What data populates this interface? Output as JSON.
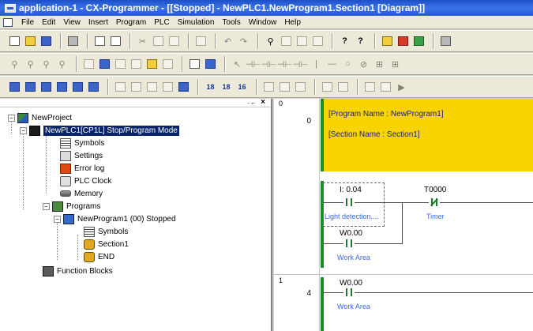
{
  "window": {
    "title": "application-1 - CX-Programmer - [[Stopped] - NewPLC1.NewProgram1.Section1 [Diagram]]"
  },
  "menu": [
    "File",
    "Edit",
    "View",
    "Insert",
    "Program",
    "PLC",
    "Simulation",
    "Tools",
    "Window",
    "Help"
  ],
  "toolbar_icons": {
    "row1": [
      "new-icon",
      "open-icon",
      "save-icon",
      "cut-icon",
      "print-icon",
      "print-preview-icon",
      "cut-icon",
      "copy-icon",
      "paste-icon",
      "grid-icon",
      "undo-icon",
      "redo-icon",
      "find-icon",
      "replace-icon",
      "find-next-icon",
      "properties-icon",
      "help-icon",
      "context-help-icon",
      "online-icon",
      "transfer-icon",
      "monitor-icon"
    ],
    "row2": [
      "zoom-fit-icon",
      "zoom-out-icon",
      "zoom-in-icon",
      "zoom-icon",
      "cross-ref-icon",
      "list-icon",
      "window-icon",
      "contact-no-icon",
      "contact-nc-icon",
      "or-no-icon",
      "or-nc-icon",
      "vertical-icon",
      "coil-icon",
      "coil-nc-icon",
      "instruction-icon",
      "fb-icon"
    ],
    "row3": [
      "toggle-workspace-icon",
      "toggle-output-icon",
      "watch-icon",
      "address-ref-icon",
      "io-table-icon",
      "settings-icon",
      "compile-icon",
      "check-icon",
      "online-edit-icon",
      "upload-icon",
      "download-icon",
      "plc-mode-icon",
      "run-icon",
      "stop-icon",
      "monitor-icon"
    ]
  },
  "toolbar_labels": {
    "zoom_a": "18",
    "zoom_b": "18",
    "zoom_c": "16"
  },
  "project_tree": {
    "root": "NewProject",
    "plc": "NewPLC1[CP1L] Stop/Program Mode",
    "plc_children": [
      "Symbols",
      "Settings",
      "Error log",
      "PLC Clock",
      "Memory"
    ],
    "programs": "Programs",
    "program": "NewProgram1 (00) Stopped",
    "program_children": [
      "Symbols",
      "Section1",
      "END"
    ],
    "function_blocks": "Function Blocks"
  },
  "diagram": {
    "rung0": {
      "index": "0",
      "step": "0",
      "program_name": "[Program Name : NewProgram1]",
      "section_name": "[Section Name : Section1]",
      "contact1_addr": "I: 0.04",
      "contact1_comment": "Light detection....",
      "contact2_addr": "T0000",
      "contact2_comment": "Timer",
      "branch_addr": "W0.00",
      "branch_comment": "Work Area"
    },
    "rung1": {
      "index": "1",
      "step": "4",
      "contact_addr": "W0.00",
      "contact_comment": "Work Area"
    }
  },
  "colors": {
    "title_bar": "#2458d6",
    "comment_block": "#f7d400",
    "rail": "#1e8a2a",
    "selection": "#0a246a"
  }
}
